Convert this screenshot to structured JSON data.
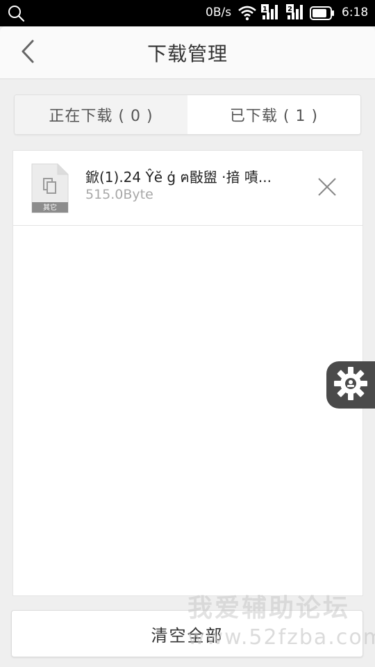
{
  "status_bar": {
    "net_speed": "0B/s",
    "sim1_label": "1",
    "sim2_label": "2",
    "time": "6:18"
  },
  "header": {
    "title": "下载管理"
  },
  "tabs": [
    {
      "label": "正在下载 ( 0 )",
      "active": false
    },
    {
      "label": "已下载 ( 1 )",
      "active": true
    }
  ],
  "downloads": [
    {
      "name": "鍁(1).24 Ŷĕ ģ ฅ敯盥 ·揞 嘖...",
      "size": "515.0Byte",
      "type_label": "其它"
    }
  ],
  "clear_button": {
    "label": "清空全部"
  },
  "watermark": {
    "text": "我爱辅助论坛",
    "url": "www.52fzba.com"
  }
}
